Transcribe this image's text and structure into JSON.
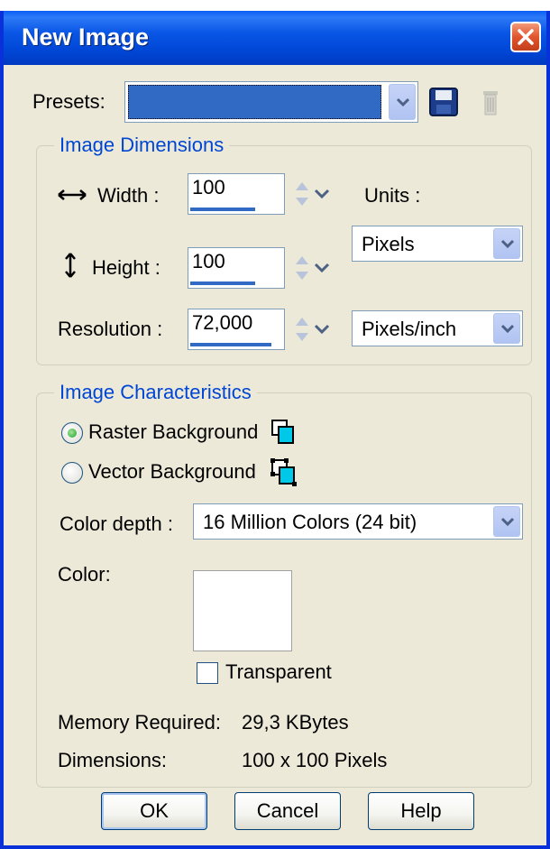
{
  "window": {
    "title": "New Image"
  },
  "presets": {
    "label": "Presets:",
    "value": ""
  },
  "image_dimensions": {
    "group_title": "Image Dimensions",
    "width_label": "Width :",
    "width_value": "100",
    "height_label": "Height :",
    "height_value": "100",
    "resolution_label": "Resolution :",
    "resolution_value": "72,000",
    "units_label": "Units :",
    "units_value": "Pixels",
    "resolution_units_value": "Pixels/inch"
  },
  "image_characteristics": {
    "group_title": "Image Characteristics",
    "raster_label": "Raster Background",
    "vector_label": "Vector Background",
    "selected_background": "raster",
    "color_depth_label": "Color depth :",
    "color_depth_value": "16 Million Colors (24 bit)",
    "color_label": "Color:",
    "color_value": "#ffffff",
    "transparent_label": "Transparent",
    "transparent_checked": false,
    "memory_label": "Memory Required:",
    "memory_value": "29,3 KBytes",
    "dimensions_label": "Dimensions:",
    "dimensions_value": "100 x 100 Pixels"
  },
  "buttons": {
    "ok": "OK",
    "cancel": "Cancel",
    "help": "Help"
  },
  "colors": {
    "titlebar": "#0046d5",
    "group_title": "#0046d5",
    "window_bg": "#ece9d8"
  }
}
